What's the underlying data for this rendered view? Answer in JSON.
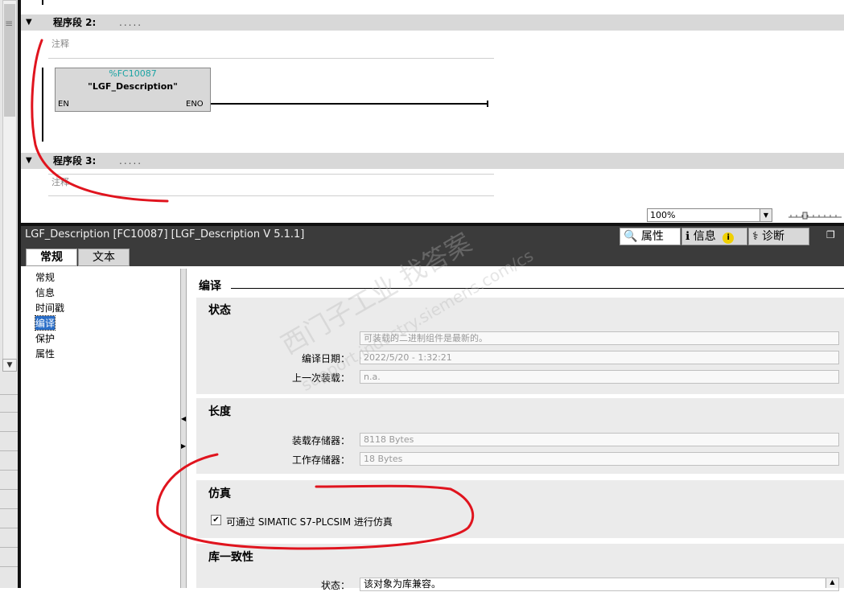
{
  "editor": {
    "network2": {
      "label": "程序段 2:",
      "dots": ".....",
      "comment": "注释"
    },
    "network3": {
      "label": "程序段 3:",
      "dots": ".....",
      "comment": "注释"
    },
    "block": {
      "address": "%FC10087",
      "name": "\"LGF_Description\"",
      "en": "EN",
      "eno": "ENO"
    },
    "zoom": "100%"
  },
  "properties": {
    "title": "LGF_Description [FC10087] [LGF_Description V 5.1.1]",
    "tabs": [
      {
        "label": "属性",
        "icon": "properties-icon"
      },
      {
        "label": "信息",
        "icon": "info-icon",
        "badge": "i"
      },
      {
        "label": "诊断",
        "icon": "diagnostics-icon"
      }
    ],
    "subtabs": [
      "常规",
      "文本"
    ],
    "nav": [
      "常规",
      "信息",
      "时间戳",
      "编译",
      "保护",
      "属性"
    ],
    "section": "编译",
    "status": {
      "title": "状态",
      "message": "可装载的二进制组件是最新的。",
      "compile_date_label": "编译日期：",
      "compile_date": "2022/5/20 - 1:32:21",
      "last_load_label": "上一次装载：",
      "last_load": "n.a."
    },
    "length": {
      "title": "长度",
      "load_memory_label": "装载存储器：",
      "load_memory": "8118 Bytes",
      "work_memory_label": "工作存储器：",
      "work_memory": "18 Bytes"
    },
    "simulation": {
      "title": "仿真",
      "checkbox_label": "可通过 SIMATIC S7-PLCSIM 进行仿真",
      "checked": true
    },
    "library": {
      "title": "库一致性",
      "status_label": "状态：",
      "status": "该对象为库兼容。"
    }
  },
  "watermark": [
    "西门子工业 找答案",
    "support.industry.siemens.com/cs"
  ],
  "annotation_color": "#e0141e"
}
